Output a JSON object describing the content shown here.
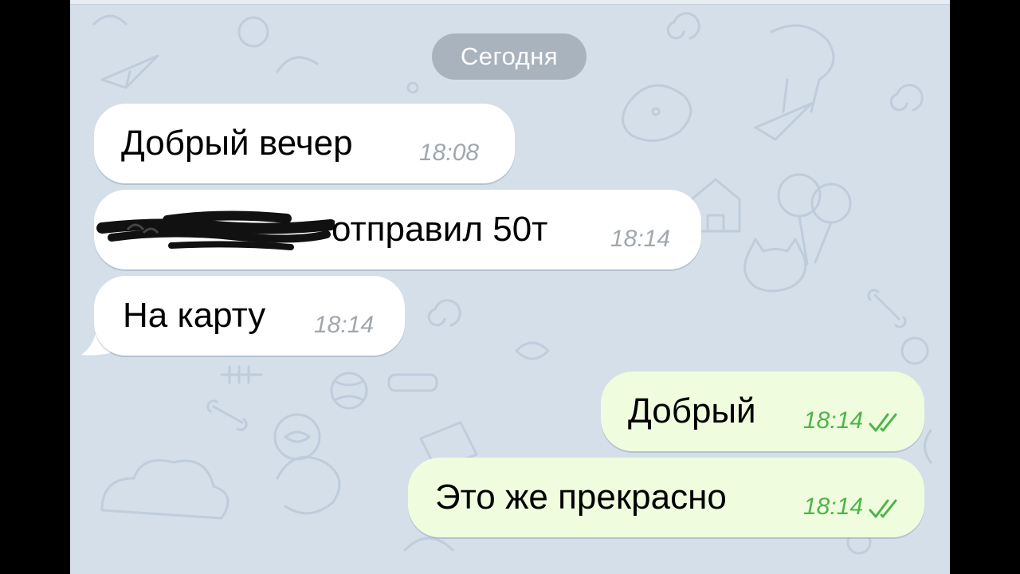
{
  "chat": {
    "date_label": "Сегодня",
    "messages": [
      {
        "text": "Добрый вечер",
        "time": "18:08",
        "direction": "incoming"
      },
      {
        "text_before_redaction": "",
        "text": "отправил 50т",
        "time": "18:14",
        "direction": "incoming",
        "redacted": true
      },
      {
        "text": "На карту",
        "time": "18:14",
        "direction": "incoming"
      },
      {
        "text": "Добрый",
        "time": "18:14",
        "direction": "outgoing",
        "status": "double-check-read"
      },
      {
        "text": "Это же прекрасно",
        "time": "18:14",
        "direction": "outgoing",
        "status": "double-check-read"
      }
    ]
  },
  "colors": {
    "background": "#d4dfea",
    "incoming_bubble": "#ffffff",
    "outgoing_bubble": "#effdde",
    "outgoing_time": "#4db548",
    "incoming_time": "#a0a7ae",
    "date_pill": "#a8b3be"
  }
}
